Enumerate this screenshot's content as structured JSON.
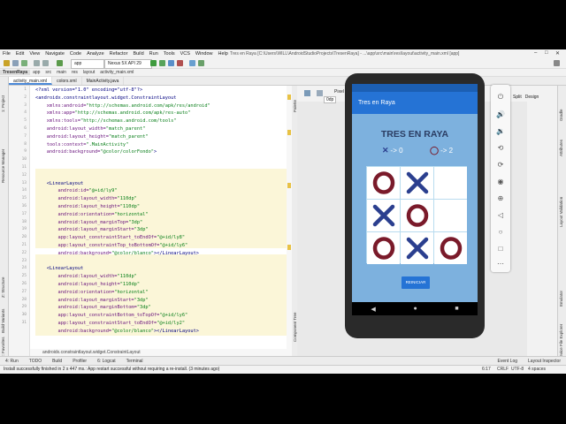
{
  "window": {
    "title": "Tres en Raya [C:\\Users\\WILL\\AndroidStudioProjects\\TresenRaya] - ...\\app\\src\\main\\res\\layout\\activity_main.xml [app]"
  },
  "menu": [
    "File",
    "Edit",
    "View",
    "Navigate",
    "Code",
    "Analyze",
    "Refactor",
    "Build",
    "Run",
    "Tools",
    "VCS",
    "Window",
    "Help"
  ],
  "toolbar": {
    "config": "app",
    "device": "Nexus 5X API 29"
  },
  "breadcrumb": [
    "TresenRaya",
    "app",
    "src",
    "main",
    "res",
    "layout",
    "activity_main.xml"
  ],
  "tabs": [
    "activity_main.xml",
    "colors.xml",
    "MainActivity.java"
  ],
  "left_tools": [
    "1: Project",
    "Resource Manager",
    "Z: Structure",
    "Build Variants",
    "2: Favorites"
  ],
  "right_tools": [
    "Gradle",
    "Attributes",
    "Layout Validation",
    "Emulator",
    "Device File Explorer"
  ],
  "editor": {
    "line_numbers": [
      "1",
      "2",
      "3",
      "4",
      "5",
      "6",
      "7",
      "8",
      "9",
      "10",
      "11",
      "12",
      "13",
      "14",
      "15",
      "16",
      "17",
      "18",
      "19",
      "20",
      "21",
      "22",
      "23",
      "24",
      "25",
      "26",
      "27",
      "28",
      "29",
      "30",
      "31"
    ],
    "path_footer": "androidx.constraintlayout.widget.ConstraintLayout"
  },
  "code": [
    [
      "",
      "",
      "",
      "<?xml version=\"1.0\" encoding=\"utf-8\"?>"
    ],
    [
      "<androidx.constraintlayout.widget.ConstraintLayout",
      "",
      "",
      ""
    ],
    [
      "    ",
      "xmlns:android=",
      "\"http://schemas.android.com/apk/res/android\"",
      ""
    ],
    [
      "    ",
      "xmlns:app=",
      "\"http://schemas.android.com/apk/res-auto\"",
      ""
    ],
    [
      "    ",
      "xmlns:tools=",
      "\"http://schemas.android.com/tools\"",
      ""
    ],
    [
      "    ",
      "android:layout_width=",
      "\"match_parent\"",
      ""
    ],
    [
      "    ",
      "android:layout_height=",
      "\"match_parent\"",
      ""
    ],
    [
      "    ",
      "tools:context=",
      "\".MainActivity\"",
      ""
    ],
    [
      "    ",
      "android:background=",
      "\"@color/colorFondo\"",
      ">"
    ],
    [
      "",
      "",
      "",
      ""
    ],
    [
      "",
      "",
      "",
      ""
    ],
    [
      "",
      "",
      "",
      ""
    ],
    [
      "    <LinearLayout",
      "",
      "",
      ""
    ],
    [
      "        ",
      "android:id=",
      "\"@+id/ly9\"",
      ""
    ],
    [
      "        ",
      "android:layout_width=",
      "\"110dp\"",
      ""
    ],
    [
      "        ",
      "android:layout_height=",
      "\"110dp\"",
      ""
    ],
    [
      "        ",
      "android:orientation=",
      "\"horizontal\"",
      ""
    ],
    [
      "        ",
      "android:layout_marginTop=",
      "\"3dp\"",
      ""
    ],
    [
      "        ",
      "android:layout_marginStart=",
      "\"3dp\"",
      ""
    ],
    [
      "        ",
      "app:layout_constraintStart_toEndOf=",
      "\"@+id/ly8\"",
      ""
    ],
    [
      "        ",
      "app:layout_constraintTop_toBottomOf=",
      "\"@+id/ly6\"",
      ""
    ],
    [
      "        ",
      "android:background=",
      "\"@color/blanco\"",
      "></LinearLayout>"
    ],
    [
      "",
      "",
      "",
      ""
    ],
    [
      "    <LinearLayout",
      "",
      "",
      ""
    ],
    [
      "        ",
      "android:layout_width=",
      "\"110dp\"",
      ""
    ],
    [
      "        ",
      "android:layout_height=",
      "\"110dp\"",
      ""
    ],
    [
      "        ",
      "android:orientation=",
      "\"horizontal\"",
      ""
    ],
    [
      "        ",
      "android:layout_marginStart=",
      "\"3dp\"",
      ""
    ],
    [
      "        ",
      "android:layout_marginBottom=",
      "\"3dp\"",
      ""
    ],
    [
      "        ",
      "app:layout_constraintBottom_toTopOf=",
      "\"@+id/ly6\"",
      ""
    ],
    [
      "        ",
      "app:layout_constraintStart_toEndOf=",
      "\"@+id/ly2\"",
      ""
    ],
    [
      "        ",
      "android:background=",
      "\"@color/blanco\"",
      "></LinearLayout>"
    ]
  ],
  "design": {
    "pixel": "Pixel",
    "dp": "0dp",
    "modes": [
      "Split",
      "Design"
    ],
    "component_tree": "Component Tree",
    "palette": "Palette"
  },
  "app": {
    "bar_title": "Tres en Raya",
    "title": "TRES EN RAYA",
    "score_x_label": "-> 0",
    "score_o_label": "-> 2",
    "board": [
      [
        "O",
        "X",
        ""
      ],
      [
        "X",
        "O",
        ""
      ],
      [
        "O",
        "X",
        "O"
      ]
    ],
    "reset_label": "REINICIAR",
    "colors": {
      "appbar": "#2573d5",
      "background": "#7db1de",
      "x_mark": "#2b3f8f",
      "o_mark": "#7a1a2a"
    }
  },
  "bottom_tools": [
    "4: Run",
    "TODO",
    "Build",
    "Profiler",
    "6: Logcat",
    "Terminal"
  ],
  "bottom_right": [
    "Event Log",
    "Layout Inspector"
  ],
  "status": {
    "message": "Install successfully finished in 2 s 447 ms.: App restart successful without requiring a re-install. (3 minutes ago)",
    "position": "6:17",
    "line_sep": "CRLF",
    "encoding": "UTF-8",
    "indent": "4 spaces"
  }
}
